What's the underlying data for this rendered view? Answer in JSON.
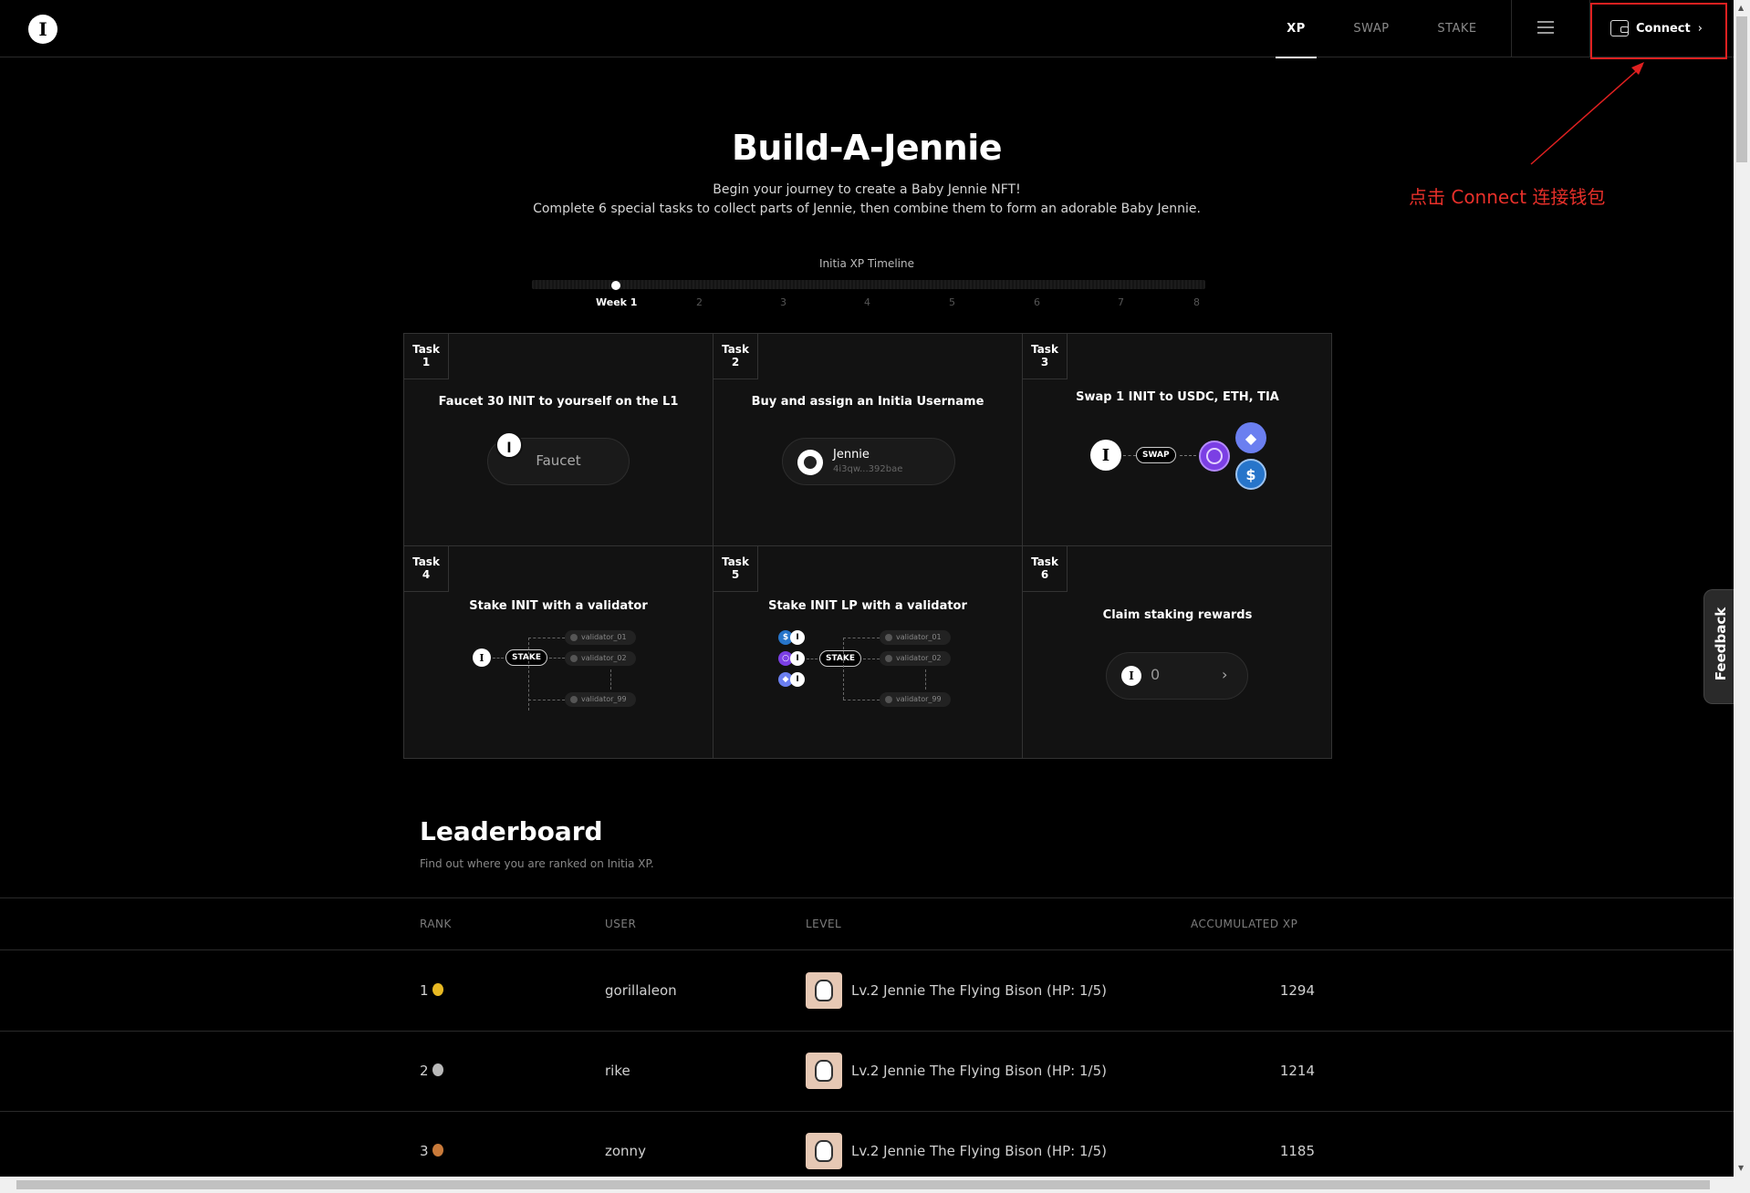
{
  "nav": {
    "items": [
      "XP",
      "SWAP",
      "STAKE"
    ],
    "active": "XP",
    "connect_label": "Connect",
    "connect_chevron": "›"
  },
  "annotation": {
    "text": "点击 Connect 连接钱包",
    "color": "#e8302a"
  },
  "hero": {
    "title": "Build-A-Jennie",
    "line1": "Begin your journey to create a Baby Jennie NFT!",
    "line2": "Complete 6 special tasks to collect parts of Jennie, then combine them to form an adorable Baby Jennie."
  },
  "timeline": {
    "label": "Initia XP Timeline",
    "ticks": [
      "Week 1",
      "2",
      "3",
      "4",
      "5",
      "6",
      "7",
      "8"
    ],
    "current_week": 1
  },
  "tasks": [
    {
      "tag": "Task",
      "num": "1",
      "title": "Faucet 30 INIT to yourself on the L1",
      "button": "Faucet"
    },
    {
      "tag": "Task",
      "num": "2",
      "title": "Buy and assign an Initia Username",
      "username": "Jennie",
      "address": "4i3qw...392bae"
    },
    {
      "tag": "Task",
      "num": "3",
      "title": "Swap 1 INIT to USDC, ETH, TIA",
      "badge": "SWAP"
    },
    {
      "tag": "Task",
      "num": "4",
      "title": "Stake INIT with a validator",
      "badge": "STAKE",
      "validators": [
        "validator_01",
        "validator_02",
        "validator_99"
      ]
    },
    {
      "tag": "Task",
      "num": "5",
      "title": "Stake INIT LP with a validator",
      "badge": "STAKE",
      "validators": [
        "validator_01",
        "validator_02",
        "validator_99"
      ]
    },
    {
      "tag": "Task",
      "num": "6",
      "title": "Claim staking rewards",
      "reward": "0",
      "chevron": "›"
    }
  ],
  "leaderboard": {
    "title": "Leaderboard",
    "subtitle": "Find out where you are ranked on Initia XP.",
    "headers": [
      "RANK",
      "USER",
      "LEVEL",
      "ACCUMULATED XP"
    ],
    "rows": [
      {
        "rank": "1",
        "medal": "gold-medal-icon",
        "user": "gorillaleon",
        "level": "Lv.2 Jennie The Flying Bison (HP: 1/5)",
        "xp": "1294"
      },
      {
        "rank": "2",
        "medal": "silver-medal-icon",
        "user": "rike",
        "level": "Lv.2 Jennie The Flying Bison (HP: 1/5)",
        "xp": "1214"
      },
      {
        "rank": "3",
        "medal": "bronze-medal-icon",
        "user": "zonny",
        "level": "Lv.2 Jennie The Flying Bison (HP: 1/5)",
        "xp": "1185"
      }
    ]
  },
  "feedback": {
    "label": "Feedback"
  },
  "colors": {
    "gold": "#e8b923",
    "silver": "#b9b9b9",
    "bronze": "#c97a3a",
    "eth": "#6b7ff0",
    "usdc": "#2775ca",
    "tia": "#7b3fe4"
  }
}
